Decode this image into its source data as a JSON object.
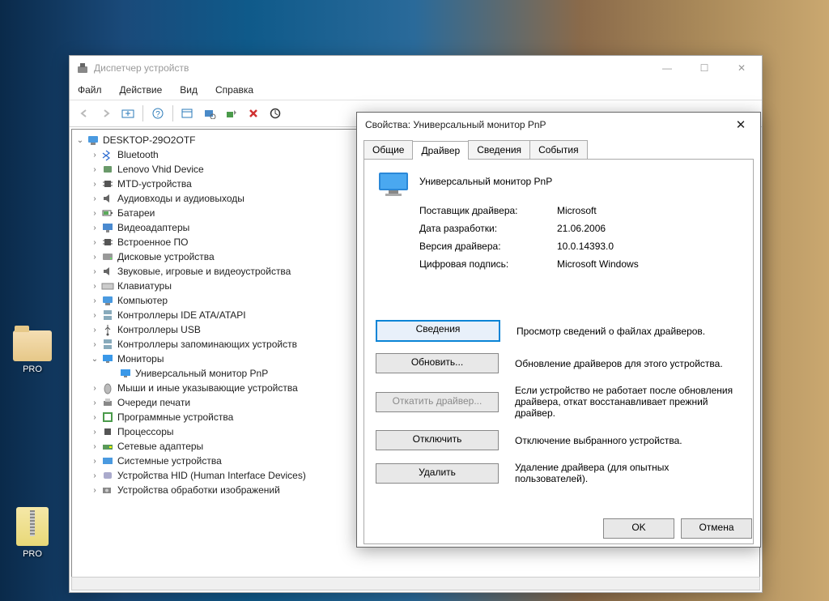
{
  "desktop": {
    "icon1_label": "PRO",
    "icon2_label": "PRO"
  },
  "devmgr": {
    "title": "Диспетчер устройств",
    "menu": {
      "file": "Файл",
      "action": "Действие",
      "view": "Вид",
      "help": "Справка"
    },
    "root": "DESKTOP-29O2OTF",
    "nodes": [
      "Bluetooth",
      "Lenovo Vhid Device",
      "MTD-устройства",
      "Аудиовходы и аудиовыходы",
      "Батареи",
      "Видеоадаптеры",
      "Встроенное ПО",
      "Дисковые устройства",
      "Звуковые, игровые и видеоустройства",
      "Клавиатуры",
      "Компьютер",
      "Контроллеры IDE ATA/ATAPI",
      "Контроллеры USB",
      "Контроллеры запоминающих устройств",
      "Мониторы",
      "Мыши и иные указывающие устройства",
      "Очереди печати",
      "Программные устройства",
      "Процессоры",
      "Сетевые адаптеры",
      "Системные устройства",
      "Устройства HID (Human Interface Devices)",
      "Устройства обработки изображений"
    ],
    "monitor_child": "Универсальный монитор PnP",
    "expanded_index": 14
  },
  "dialog": {
    "title": "Свойства: Универсальный монитор PnP",
    "tabs": {
      "general": "Общие",
      "driver": "Драйвер",
      "details": "Сведения",
      "events": "События"
    },
    "active_tab": "driver",
    "device_name": "Универсальный монитор PnP",
    "props": {
      "provider_label": "Поставщик драйвера:",
      "provider_value": "Microsoft",
      "date_label": "Дата разработки:",
      "date_value": "21.06.2006",
      "version_label": "Версия драйвера:",
      "version_value": "10.0.14393.0",
      "signer_label": "Цифровая подпись:",
      "signer_value": "Microsoft Windows"
    },
    "buttons": {
      "details": "Сведения",
      "details_desc": "Просмотр сведений о файлах драйверов.",
      "update": "Обновить...",
      "update_desc": "Обновление драйверов для этого устройства.",
      "rollback": "Откатить драйвер...",
      "rollback_desc": "Если устройство не работает после обновления драйвера, откат восстанавливает прежний драйвер.",
      "disable": "Отключить",
      "disable_desc": "Отключение выбранного устройства.",
      "uninstall": "Удалить",
      "uninstall_desc": "Удаление драйвера (для опытных пользователей)."
    },
    "ok": "OK",
    "cancel": "Отмена"
  }
}
